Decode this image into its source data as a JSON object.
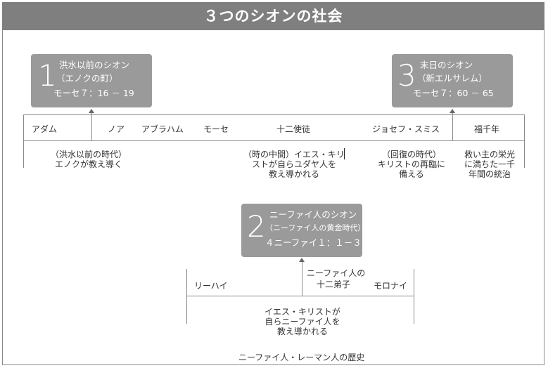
{
  "title": "３つのシオンの社会",
  "zion1": {
    "number": "1",
    "line1": "洪水以前のシオン",
    "line2": "（エノクの町）",
    "ref": "モーセ７：16 － 19"
  },
  "zion3": {
    "number": "3",
    "line1": "末日のシオン",
    "line2": "（新エルサレム）",
    "ref": "モーセ７：60 － 65"
  },
  "zion2": {
    "number": "2",
    "line1": "ニーファイ人のシオン",
    "line2": "（ニーファイ人の黄金時代）",
    "ref": "４ニーファイ１：１－３"
  },
  "timeline_top": {
    "eras": [
      "アダム",
      "ノア",
      "アブラハム",
      "モーセ",
      "十二使徒",
      "ジョセフ・スミス",
      "福千年"
    ],
    "desc1": [
      "（洪水以前の時代）",
      "エノクが教え導く"
    ],
    "desc2": [
      "（時の中間）イエス・キリ",
      "ストが自らユダヤ人を",
      "教え導かれる"
    ],
    "desc3": [
      "（回復の時代）",
      "キリストの再臨に",
      "備える"
    ],
    "desc4": [
      "救い主の栄光",
      "に満ちた一千",
      "年間の統治"
    ]
  },
  "timeline_bottom": {
    "eras": [
      "リーハイ",
      "ニーファイ人の",
      "十二弟子",
      "モロナイ"
    ],
    "desc": [
      "イエス・キリストが",
      "自らニーファイ人を",
      "教え導かれる"
    ],
    "caption": "ニーファイ人・レーマン人の歴史"
  },
  "colors": {
    "title_bg": "#7f7f7f",
    "box_bg": "#9a9a9a",
    "line": "#8a8a8a"
  }
}
